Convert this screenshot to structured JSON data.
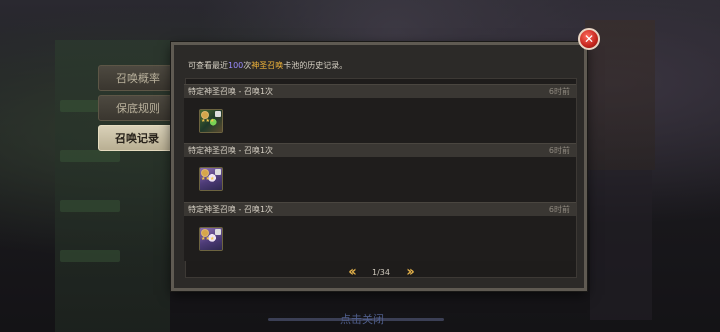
{
  "side_tabs": [
    {
      "label": "召唤概率",
      "active": false
    },
    {
      "label": "保底规则",
      "active": false
    },
    {
      "label": "召唤记录",
      "active": true
    }
  ],
  "modal": {
    "desc_prefix": "可查看最近",
    "desc_count": "100",
    "desc_mid": "次",
    "desc_pool": "神圣召唤",
    "desc_suffix": "卡池的历史记录。",
    "entries": [
      {
        "title": "特定神圣召唤 - 召唤1次",
        "time": "6时前",
        "hero": {
          "art": "green-hero-portrait",
          "element": "light-element-icon",
          "role": "class-icon"
        }
      },
      {
        "title": "特定神圣召唤 - 召唤1次",
        "time": "6时前",
        "hero": {
          "art": "purple-hero-portrait",
          "element": "light-element-icon",
          "role": "class-icon"
        }
      },
      {
        "title": "特定神圣召唤 - 召唤1次",
        "time": "6时前",
        "hero": {
          "art": "purple-hero-portrait",
          "element": "light-element-icon",
          "role": "class-icon"
        }
      }
    ],
    "pager": {
      "current": 1,
      "total": 34,
      "label": "1/34"
    }
  },
  "close_button": {
    "icon": "close-icon",
    "color": "#c4261d"
  },
  "tap_to_close": "点击关闭",
  "colors": {
    "highlight_count": "#9b8cff",
    "highlight_pool": "#f0b43a",
    "pager_arrow": "#e2b04a"
  }
}
